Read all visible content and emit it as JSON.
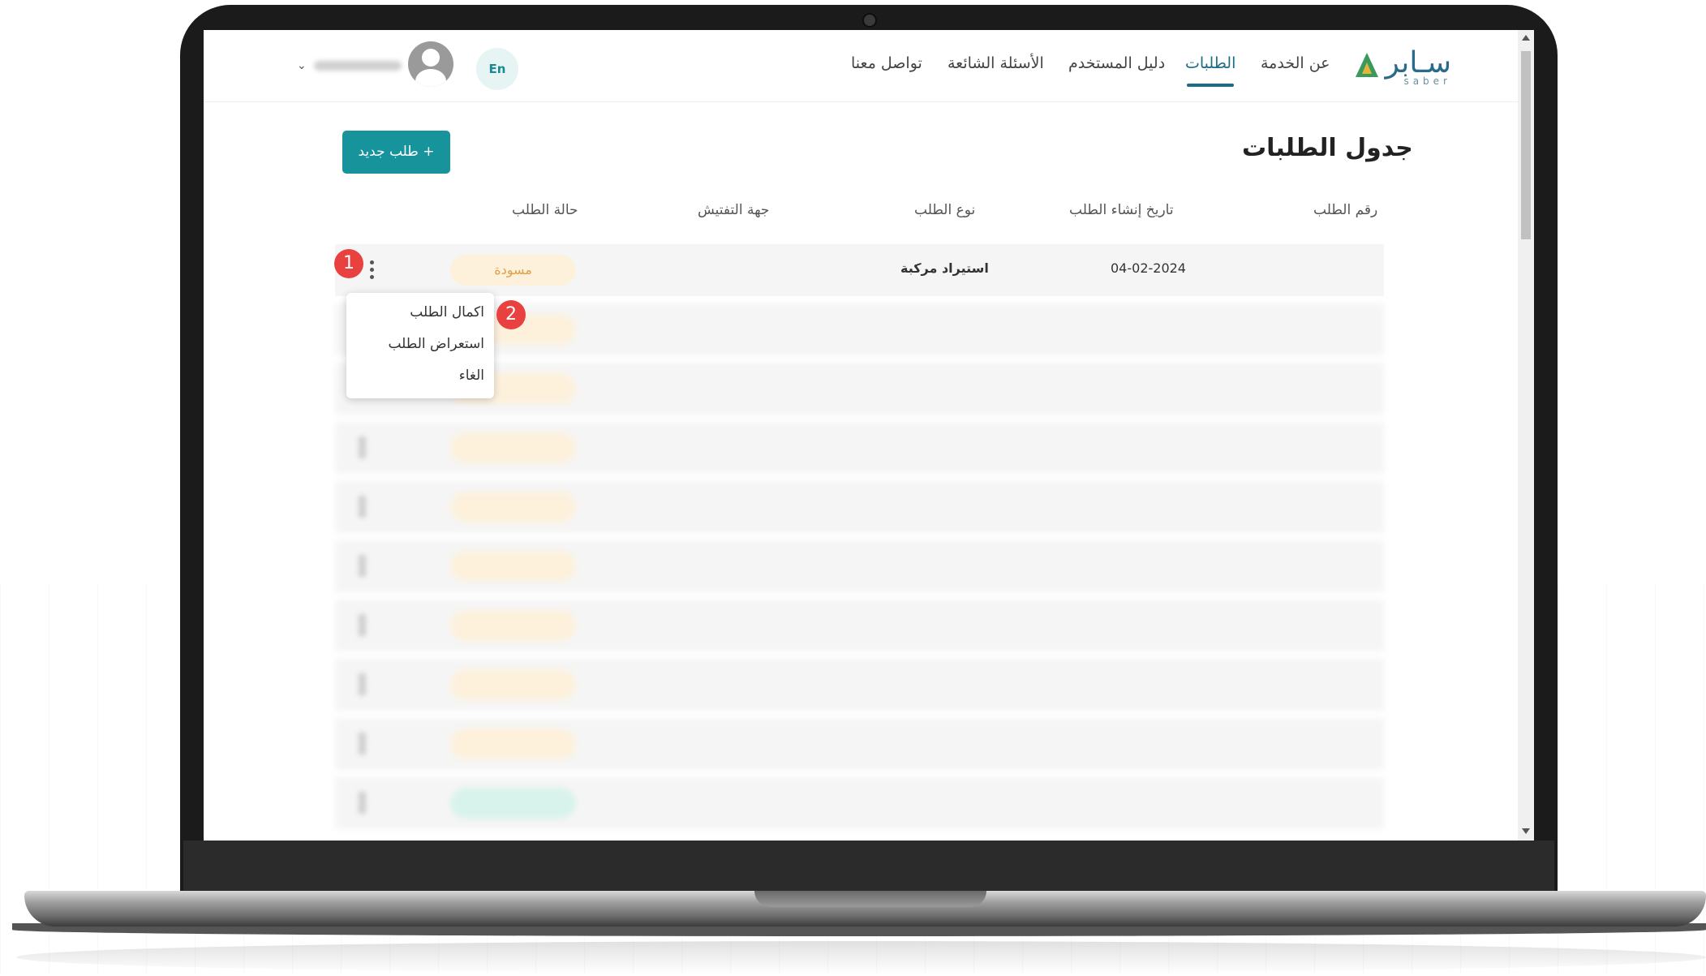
{
  "nav": {
    "logo_text": "سـابر",
    "logo_sub": "saber",
    "items": [
      "عن الخدمة",
      "الطلبات",
      "دليل المستخدم",
      "الأسئلة الشائعة",
      "تواصل معنا"
    ],
    "active_index": 1,
    "lang_label": "En"
  },
  "page": {
    "title": "جدول الطلبات",
    "new_request_label": "+  طلب جديد"
  },
  "table": {
    "headers": [
      "رقم الطلب",
      "تاريخ إنشاء الطلب",
      "نوع الطلب",
      "جهة التفتيش",
      "حالة الطلب"
    ],
    "first_row": {
      "number": "",
      "date": "04-02-2024",
      "type": "استيراد مركبة",
      "inspector": "",
      "status": "مسودة"
    }
  },
  "context_menu": {
    "items": [
      "اكمال الطلب",
      "استعراض الطلب",
      "الغاء"
    ]
  },
  "markers": [
    "1",
    "2"
  ]
}
